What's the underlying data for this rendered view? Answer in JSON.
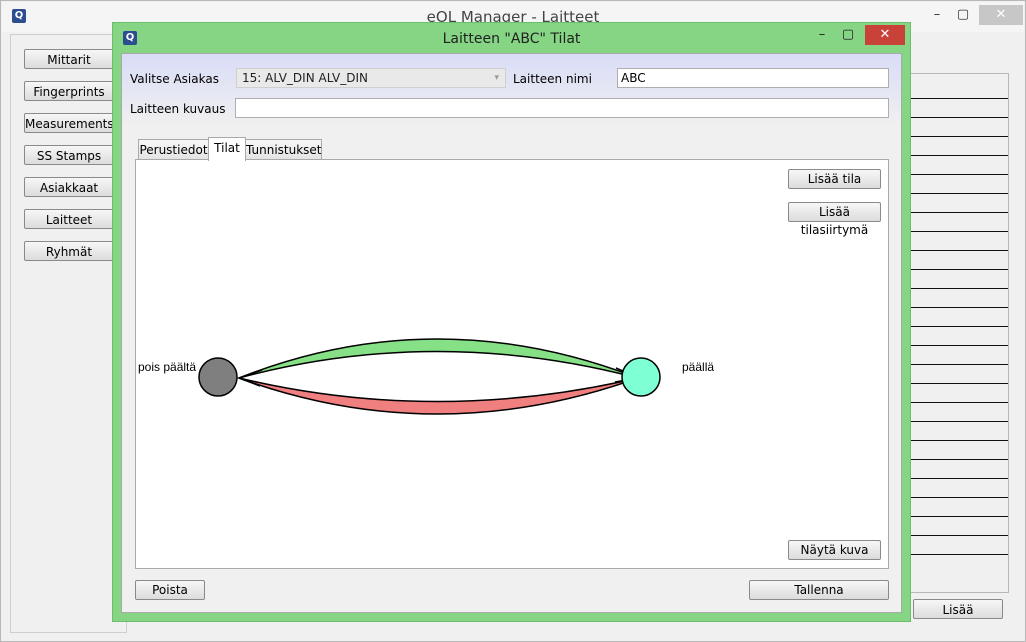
{
  "outer_window": {
    "title": "eOL Manager - Laitteet",
    "controls": {
      "minimize": "–",
      "maximize": "▢",
      "close": "✕"
    }
  },
  "sidebar": {
    "items": [
      {
        "label": "Mittarit"
      },
      {
        "label": "Fingerprints"
      },
      {
        "label": "Measurements"
      },
      {
        "label": "SS Stamps"
      },
      {
        "label": "Asiakkaat"
      },
      {
        "label": "Laitteet"
      },
      {
        "label": "Ryhmät"
      }
    ]
  },
  "right_panel": {
    "add_label": "Lisää"
  },
  "dialog": {
    "title": "Laitteen \"ABC\" Tilat",
    "controls": {
      "minimize": "–",
      "maximize": "▢",
      "close": "✕"
    },
    "customer_label": "Valitse Asiakas",
    "customer_value": "15: ALV_DIN ALV_DIN",
    "device_name_label": "Laitteen nimi",
    "device_name_value": "ABC",
    "description_label": "Laitteen kuvaus",
    "description_value": "",
    "tabs": [
      {
        "label": "Perustiedot",
        "active": false
      },
      {
        "label": "Tilat",
        "active": true
      },
      {
        "label": "Tunnistukset",
        "active": false
      }
    ],
    "buttons": {
      "add_state": "Lisää tila",
      "add_transition": "Lisää tilasiirtymä",
      "show_image": "Näytä kuva",
      "delete": "Poista",
      "save": "Tallenna"
    },
    "states": [
      {
        "label": "pois päältä",
        "color": "#7f7f7f"
      },
      {
        "label": "päällä",
        "color": "#7fffd4"
      }
    ],
    "transitions": [
      {
        "from": "pois päältä",
        "to": "päällä",
        "color": "#86e086"
      },
      {
        "from": "päällä",
        "to": "pois päältä",
        "color": "#f07f7f"
      }
    ]
  }
}
